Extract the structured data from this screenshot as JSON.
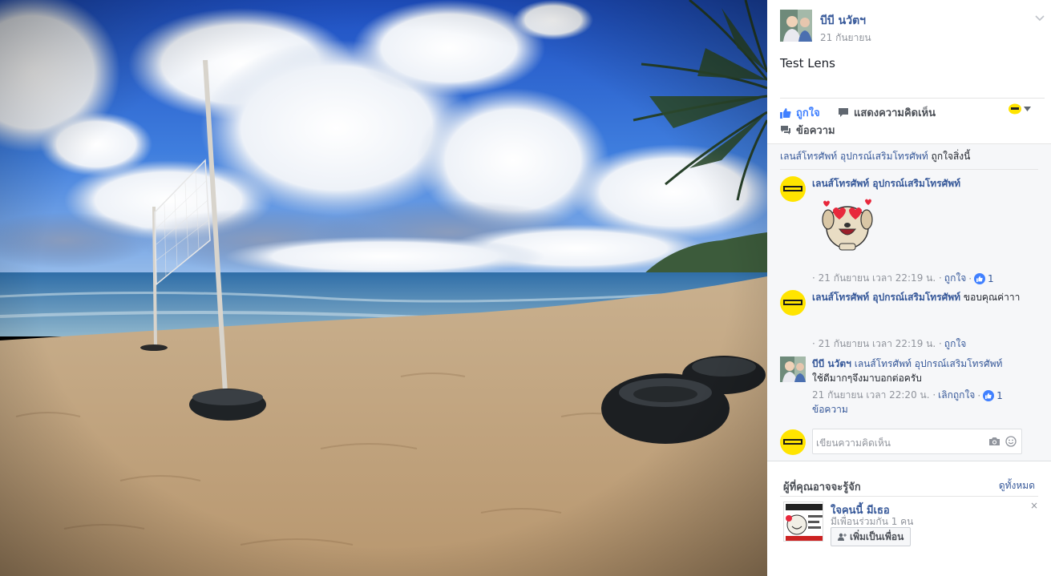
{
  "post": {
    "author": "บีบี นวัตฯ",
    "date": "21 กันยายน",
    "text": "Test Lens"
  },
  "actions": {
    "like": "ถูกใจ",
    "comment": "แสดงความคิดเห็น",
    "message": "ข้อความ"
  },
  "likes": {
    "page": "เลนส์โทรศัพท์ อุปกรณ์เสริมโทรศัพท์",
    "suffix": " ถูกใจสิ่งนี้"
  },
  "comments": [
    {
      "author": "เลนส์โทรศัพท์ อุปกรณ์เสริมโทรศัพท์",
      "text": "",
      "time": "· 21 กันยายน เวลา 22:19 น. ·",
      "like": "ถูกใจ",
      "sep": "·",
      "count": "1"
    },
    {
      "author": "เลนส์โทรศัพท์ อุปกรณ์เสริมโทรศัพท์",
      "text": " ขอบคุณค่าาา",
      "time": "· 21 กันยายน เวลา 22:19 น. ·",
      "like": "ถูกใจ"
    },
    {
      "author": "บีบี นวัตฯ",
      "mention": "เลนส์โทรศัพท์ อุปกรณ์เสริมโทรศัพท์",
      "text": "ใช้ดีมากๆจึงมาบอกต่อครับ",
      "time": "21 กันยายน เวลา 22:20 น. ·",
      "like": "เลิกถูกใจ",
      "sep": "·",
      "count": "1",
      "reply": "ข้อความ"
    }
  ],
  "composer": {
    "placeholder": "เขียนความคิดเห็น"
  },
  "pymk": {
    "title": "ผู้ที่คุณอาจจะรู้จัก",
    "see_all": "ดูทั้งหมด",
    "name": "ใจคนนี้ มีเธอ",
    "mutual": "มีเพื่อนร่วมกัน 1 คน",
    "add": "เพิ่มเป็นเพื่อน",
    "close": "×"
  },
  "colors": {
    "link": "#365899",
    "muted": "#90949c",
    "like_blue": "#4080ff",
    "page_avatar": "#ffe400"
  }
}
